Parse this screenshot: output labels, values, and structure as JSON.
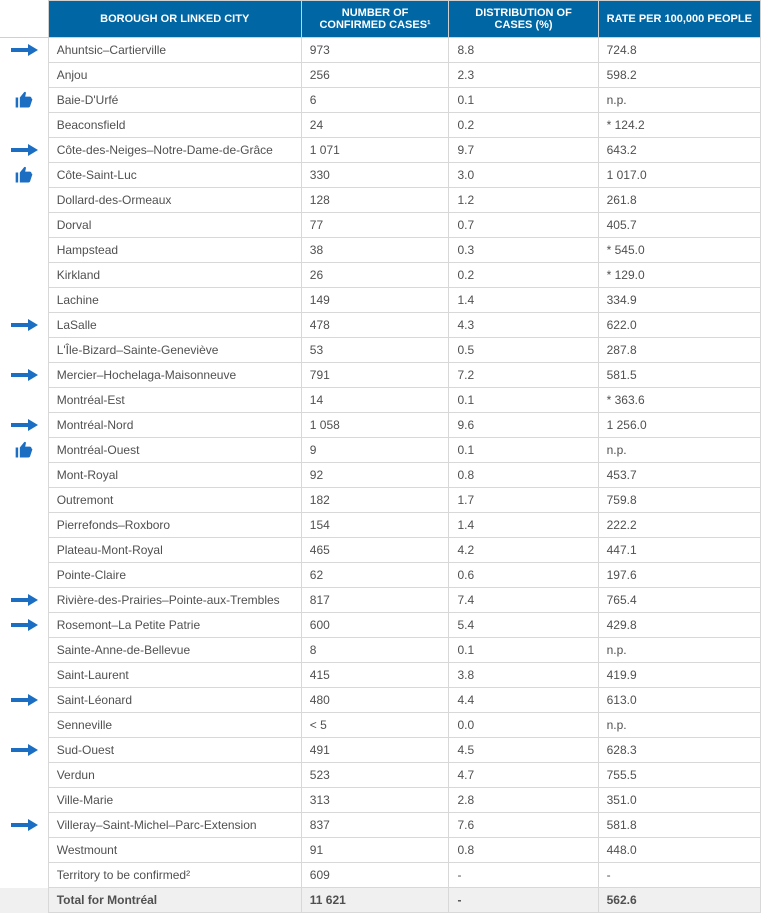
{
  "headers": {
    "borough": "BOROUGH OR LINKED CITY",
    "cases": "NUMBER OF CONFIRMED CASES¹",
    "distribution": "DISTRIBUTION OF CASES (%)",
    "rate": "RATE PER 100,000 PEOPLE"
  },
  "icons": {
    "arrow": "arrow-right-icon",
    "thumb": "thumbs-up-icon",
    "none": ""
  },
  "rows": [
    {
      "icon": "arrow",
      "borough": "Ahuntsic–Cartierville",
      "cases": "973",
      "dist": "8.8",
      "rate": "724.8"
    },
    {
      "icon": "",
      "borough": "Anjou",
      "cases": "256",
      "dist": "2.3",
      "rate": "598.2"
    },
    {
      "icon": "thumb",
      "borough": "Baie-D'Urfé",
      "cases": "6",
      "dist": "0.1",
      "rate": "n.p."
    },
    {
      "icon": "",
      "borough": "Beaconsfield",
      "cases": "24",
      "dist": "0.2",
      "rate": "* 124.2"
    },
    {
      "icon": "arrow",
      "borough": "Côte-des-Neiges–Notre-Dame-de-Grâce",
      "cases": "1 071",
      "dist": "9.7",
      "rate": "643.2"
    },
    {
      "icon": "thumb",
      "borough": "Côte-Saint-Luc",
      "cases": "330",
      "dist": "3.0",
      "rate": "1 017.0"
    },
    {
      "icon": "",
      "borough": "Dollard-des-Ormeaux",
      "cases": "128",
      "dist": "1.2",
      "rate": "261.8"
    },
    {
      "icon": "",
      "borough": "Dorval",
      "cases": "77",
      "dist": " 0.7",
      "rate": "405.7"
    },
    {
      "icon": "",
      "borough": "Hampstead",
      "cases": "38",
      "dist": "0.3",
      "rate": "* 545.0"
    },
    {
      "icon": "",
      "borough": "Kirkland",
      "cases": "26",
      "dist": "0.2",
      "rate": "* 129.0"
    },
    {
      "icon": "",
      "borough": "Lachine",
      "cases": "149",
      "dist": " 1.4",
      "rate": "334.9"
    },
    {
      "icon": "arrow",
      "borough": "LaSalle",
      "cases": "478",
      "dist": "4.3",
      "rate": "622.0"
    },
    {
      "icon": "",
      "borough": "L'Île-Bizard–Sainte-Geneviève",
      "cases": " 53",
      "dist": "0.5",
      "rate": "287.8"
    },
    {
      "icon": "arrow",
      "borough": "Mercier–Hochelaga-Maisonneuve",
      "cases": "791",
      "dist": "7.2",
      "rate": "581.5"
    },
    {
      "icon": "",
      "borough": "Montréal-Est",
      "cases": "14",
      "dist": "0.1",
      "rate": "* 363.6"
    },
    {
      "icon": "arrow",
      "borough": "Montréal-Nord",
      "cases": "1 058",
      "dist": "9.6",
      "rate": "1 256.0"
    },
    {
      "icon": "thumb",
      "borough": "Montréal-Ouest",
      "cases": "9",
      "dist": "0.1",
      "rate": "n.p."
    },
    {
      "icon": "",
      "borough": "Mont-Royal",
      "cases": "92",
      "dist": "0.8",
      "rate": "453.7"
    },
    {
      "icon": "",
      "borough": "Outremont",
      "cases": "182",
      "dist": "1.7",
      "rate": "759.8"
    },
    {
      "icon": "",
      "borough": "Pierrefonds–Roxboro",
      "cases": "154",
      "dist": "1.4",
      "rate": "222.2"
    },
    {
      "icon": "",
      "borough": "Plateau-Mont-Royal",
      "cases": "465",
      "dist": "4.2",
      "rate": "447.1"
    },
    {
      "icon": "",
      "borough": "Pointe-Claire",
      "cases": "62",
      "dist": "0.6",
      "rate": "197.6"
    },
    {
      "icon": "arrow",
      "borough": "Rivière-des-Prairies–Pointe-aux-Trembles",
      "cases": "817",
      "dist": "7.4",
      "rate": "765.4"
    },
    {
      "icon": "arrow",
      "borough": "Rosemont–La Petite Patrie",
      "cases": "600",
      "dist": "5.4",
      "rate": "429.8"
    },
    {
      "icon": "",
      "borough": "Sainte-Anne-de-Bellevue",
      "cases": "8",
      "dist": "0.1",
      "rate": "n.p."
    },
    {
      "icon": "",
      "borough": "Saint-Laurent",
      "cases": "415",
      "dist": "3.8",
      "rate": "419.9"
    },
    {
      "icon": "arrow",
      "borough": "Saint-Léonard",
      "cases": "480",
      "dist": " 4.4",
      "rate": "613.0"
    },
    {
      "icon": "",
      "borough": "Senneville",
      "cases": "< 5",
      "dist": "0.0",
      "rate": "n.p."
    },
    {
      "icon": "arrow",
      "borough": "Sud-Ouest",
      "cases": "491",
      "dist": "4.5",
      "rate": "628.3"
    },
    {
      "icon": "",
      "borough": "Verdun",
      "cases": "523",
      "dist": "4.7",
      "rate": "755.5"
    },
    {
      "icon": "",
      "borough": "Ville-Marie",
      "cases": "313",
      "dist": " 2.8",
      "rate": "351.0"
    },
    {
      "icon": "arrow",
      "borough": "Villeray–Saint-Michel–Parc-Extension",
      "cases": "837",
      "dist": "7.6",
      "rate": "581.8"
    },
    {
      "icon": "",
      "borough": "Westmount",
      "cases": "91",
      "dist": "0.8",
      "rate": "448.0"
    },
    {
      "icon": "",
      "borough": "Territory to be confirmed²",
      "cases": "609",
      "dist": "-",
      "rate": "-"
    }
  ],
  "total": {
    "label": "Total for Montréal",
    "cases": "11 621",
    "dist": "-",
    "rate": "562.6"
  }
}
